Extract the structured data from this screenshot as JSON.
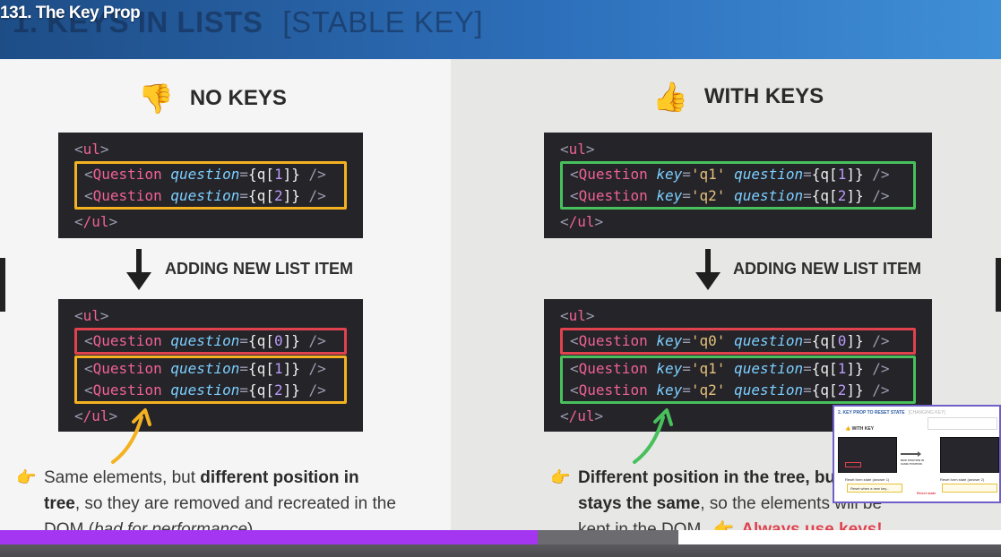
{
  "video": {
    "title": "131. The Key Prop",
    "progress_percent": 53.7,
    "buffered_percent": 67.8
  },
  "slide": {
    "heading_bold": "1. KEYS IN LISTS",
    "heading_light": "[STABLE KEY]",
    "left": {
      "icon": "thumbs-down-icon",
      "title": "NO KEYS",
      "step_label": "ADDING NEW LIST ITEM",
      "note": {
        "t1": "Same elements, but ",
        "b1": "different position in tree",
        "t2": ", so they are removed and recreated in the DOM (",
        "i1": "bad for performance",
        "t3": ")"
      }
    },
    "right": {
      "icon": "thumbs-up-icon",
      "title": "WITH KEYS",
      "step_label": "ADDING NEW LIST ITEM",
      "note": {
        "b1": "Different position in the tree, but the key stays the same",
        "t1": ", so the elements will be kept in the DOM",
        "cta": "Always use keys!"
      }
    },
    "code": {
      "ul_open": "ul",
      "ul_close": "/ul",
      "tag": "Question",
      "key_attr": "key",
      "question_attr": "question",
      "var": "q",
      "keys": [
        "'q0'",
        "'q1'",
        "'q2'"
      ],
      "indices": [
        "0",
        "1",
        "2"
      ]
    }
  },
  "preview": {
    "heading_blue": "2. KEY PROP TO RESET STATE",
    "heading_gray": "[CHANGING KEY]",
    "col_label": "WITH KEY",
    "caption": "NEW POSITION IN SAME POSITION",
    "field_label_1": "Reset form state (answer 1)",
    "field_label_2": "Reset form state (answer 2)",
    "field_value": "Reset when a new key...",
    "cta": "Reset state"
  },
  "colors": {
    "highlight_orange": "#f4b221",
    "highlight_green": "#48c05c",
    "highlight_red": "#e0424e",
    "progress_played": "#a435f0",
    "banner_blue": "#2d6fba"
  }
}
